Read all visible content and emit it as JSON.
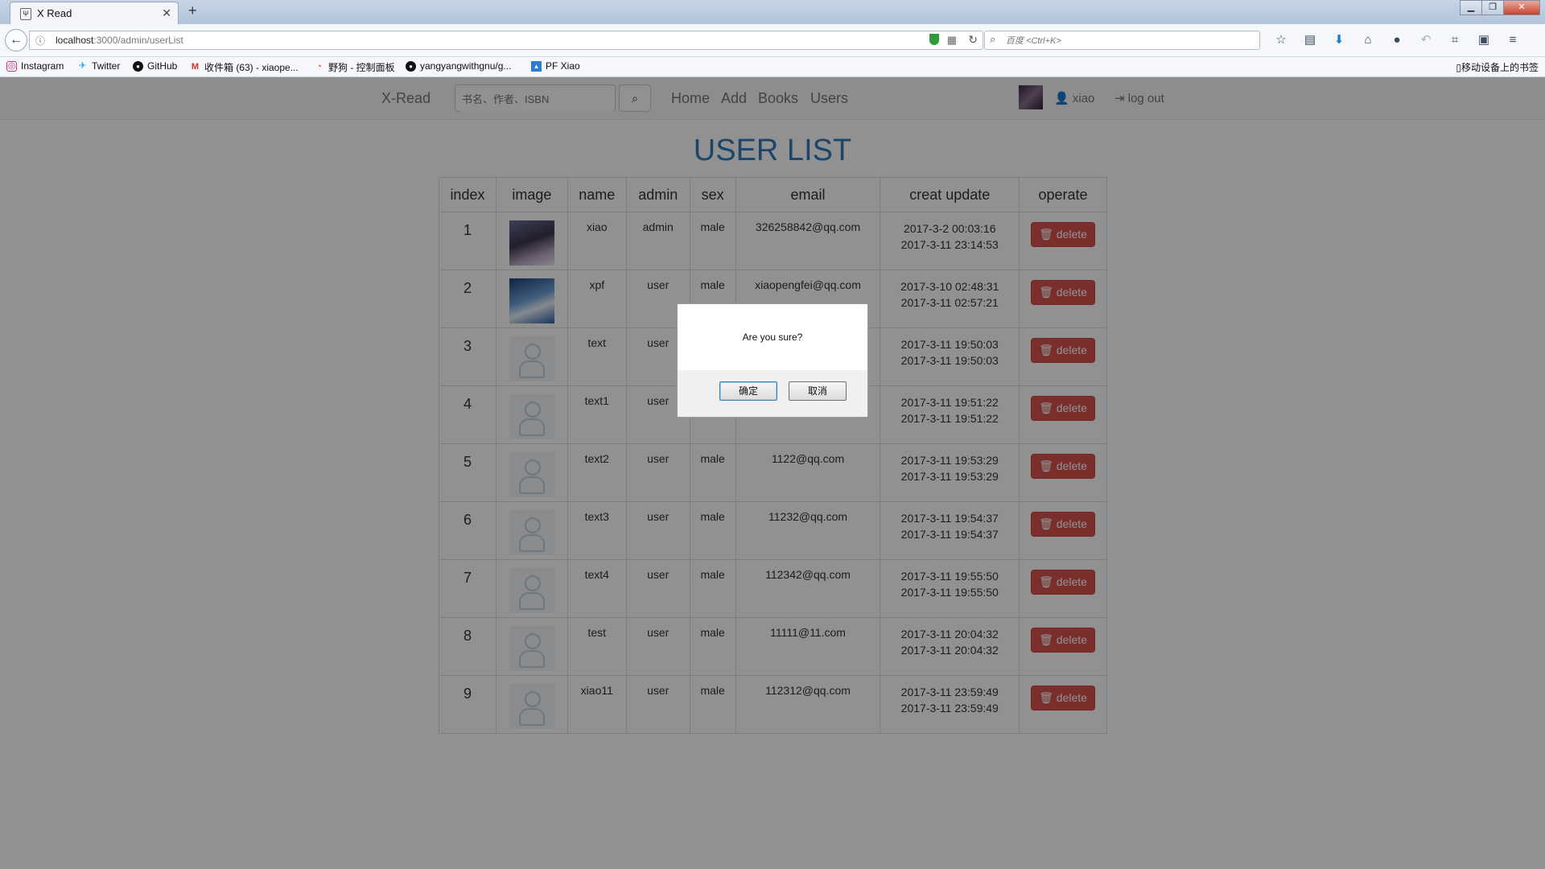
{
  "browser": {
    "tab_title": "X Read",
    "tab_favicon": "Ψ",
    "url_host": "localhost",
    "url_rest": ":3000/admin/userList",
    "search_placeholder": "百度 <Ctrl+K>",
    "bookmarks": [
      {
        "label": "Instagram",
        "icon": "instagram-icon",
        "color": "#c13584"
      },
      {
        "label": "Twitter",
        "icon": "twitter-icon",
        "color": "#1da1f2"
      },
      {
        "label": "GitHub",
        "icon": "github-icon",
        "color": "#111111"
      },
      {
        "label": "收件箱 (63) - xiaope...",
        "icon": "gmail-icon",
        "color": "#d93025"
      },
      {
        "label": "野狗 - 控制面板",
        "icon": "wilddog-icon",
        "color": "#e8512f"
      },
      {
        "label": "yangyangwithgnu/g...",
        "icon": "github-icon",
        "color": "#111111"
      },
      {
        "label": "PF Xiao",
        "icon": "picture-icon",
        "color": "#2b7cd3"
      }
    ],
    "mobile_bookmarks": "移动设备上的书签"
  },
  "site": {
    "brand": "X-Read",
    "search_placeholder": "书名、作者、ISBN",
    "nav": [
      "Home",
      "Add",
      "Books",
      "Users"
    ],
    "user": "xiao",
    "logout": "log out"
  },
  "page_title": "USER LIST",
  "table": {
    "headers": [
      "index",
      "image",
      "name",
      "admin",
      "sex",
      "email",
      "creat update",
      "operate"
    ],
    "delete_label": "delete",
    "rows": [
      {
        "index": "1",
        "image": "avatar-1",
        "name": "xiao",
        "admin": "admin",
        "sex": "male",
        "email": "326258842@qq.com",
        "created": "2017-3-2 00:03:16",
        "updated": "2017-3-11 23:14:53"
      },
      {
        "index": "2",
        "image": "avatar-2",
        "name": "xpf",
        "admin": "user",
        "sex": "male",
        "email": "xiaopengfei@qq.com",
        "created": "2017-3-10 02:48:31",
        "updated": "2017-3-11 02:57:21"
      },
      {
        "index": "3",
        "image": "placeholder",
        "name": "text",
        "admin": "user",
        "sex": "",
        "email": "",
        "created": "2017-3-11 19:50:03",
        "updated": "2017-3-11 19:50:03"
      },
      {
        "index": "4",
        "image": "placeholder",
        "name": "text1",
        "admin": "user",
        "sex": "",
        "email": "",
        "created": "2017-3-11 19:51:22",
        "updated": "2017-3-11 19:51:22"
      },
      {
        "index": "5",
        "image": "placeholder",
        "name": "text2",
        "admin": "user",
        "sex": "male",
        "email": "1122@qq.com",
        "created": "2017-3-11 19:53:29",
        "updated": "2017-3-11 19:53:29"
      },
      {
        "index": "6",
        "image": "placeholder",
        "name": "text3",
        "admin": "user",
        "sex": "male",
        "email": "11232@qq.com",
        "created": "2017-3-11 19:54:37",
        "updated": "2017-3-11 19:54:37"
      },
      {
        "index": "7",
        "image": "placeholder",
        "name": "text4",
        "admin": "user",
        "sex": "male",
        "email": "112342@qq.com",
        "created": "2017-3-11 19:55:50",
        "updated": "2017-3-11 19:55:50"
      },
      {
        "index": "8",
        "image": "placeholder",
        "name": "test",
        "admin": "user",
        "sex": "male",
        "email": "11111@11.com",
        "created": "2017-3-11 20:04:32",
        "updated": "2017-3-11 20:04:32"
      },
      {
        "index": "9",
        "image": "placeholder",
        "name": "xiao11",
        "admin": "user",
        "sex": "male",
        "email": "112312@qq.com",
        "created": "2017-3-11 23:59:49",
        "updated": "2017-3-11 23:59:49"
      }
    ]
  },
  "dialog": {
    "message": "Are you sure?",
    "ok": "确定",
    "cancel": "取消"
  },
  "colors": {
    "accent": "#337ab7",
    "danger": "#d9534f"
  }
}
